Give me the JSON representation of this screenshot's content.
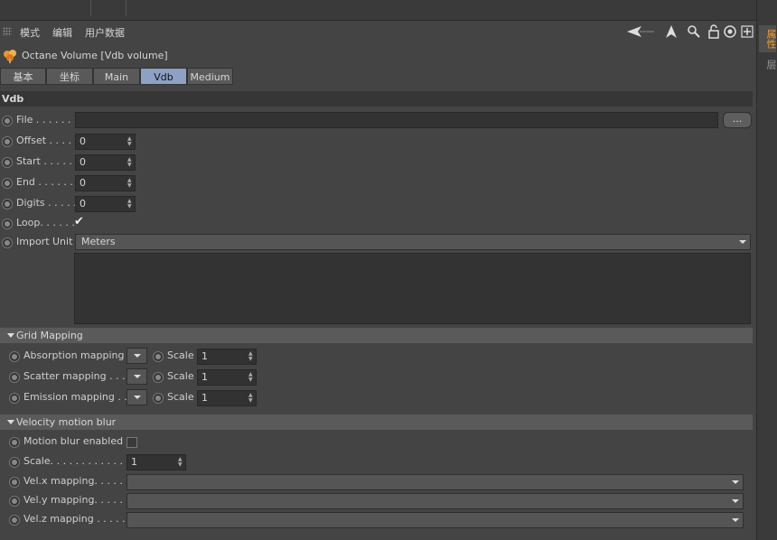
{
  "menubar": {
    "items": [
      "模式",
      "编辑",
      "用户数据"
    ]
  },
  "side_tabs": [
    "属性",
    "层"
  ],
  "object": {
    "title": "Octane Volume [Vdb volume]",
    "icon": "octane-volume-icon"
  },
  "tabs": [
    {
      "label": "基本",
      "active": false
    },
    {
      "label": "坐标",
      "active": false
    },
    {
      "label": "Main",
      "active": false
    },
    {
      "label": "Vdb",
      "active": true
    },
    {
      "label": "Medium",
      "active": false
    }
  ],
  "vdb": {
    "section_title": "Vdb",
    "file_label": "File . . . . . . .",
    "file_value": "",
    "browse_label": "...",
    "offset_label": "Offset . . . . .",
    "offset_value": "0",
    "start_label": "Start . . . . . .",
    "start_value": "0",
    "end_label": "End . . . . . . .",
    "end_value": "0",
    "digits_label": "Digits . . . . .",
    "digits_value": "0",
    "loop_label": "Loop. . . . . .",
    "loop_checked": "✔",
    "import_unit_label": "Import Unit",
    "import_unit_value": "Meters"
  },
  "grid_mapping": {
    "title": "Grid Mapping",
    "rows": [
      {
        "label": "Absorption mapping",
        "scale_label": "Scale",
        "scale_value": "1"
      },
      {
        "label": "Scatter mapping . . . .",
        "scale_label": "Scale",
        "scale_value": "1"
      },
      {
        "label": "Emission mapping . .",
        "scale_label": "Scale",
        "scale_value": "1"
      }
    ]
  },
  "velocity": {
    "title": "Velocity motion blur",
    "enabled_label": "Motion blur enabled",
    "scale_label": "Scale. . . . . . . . . . . . . .",
    "scale_value": "1",
    "velx_label": "Vel.x mapping. . . . . .",
    "vely_label": "Vel.y mapping. . . . . .",
    "velz_label": "Vel.z mapping . . . . . ."
  }
}
